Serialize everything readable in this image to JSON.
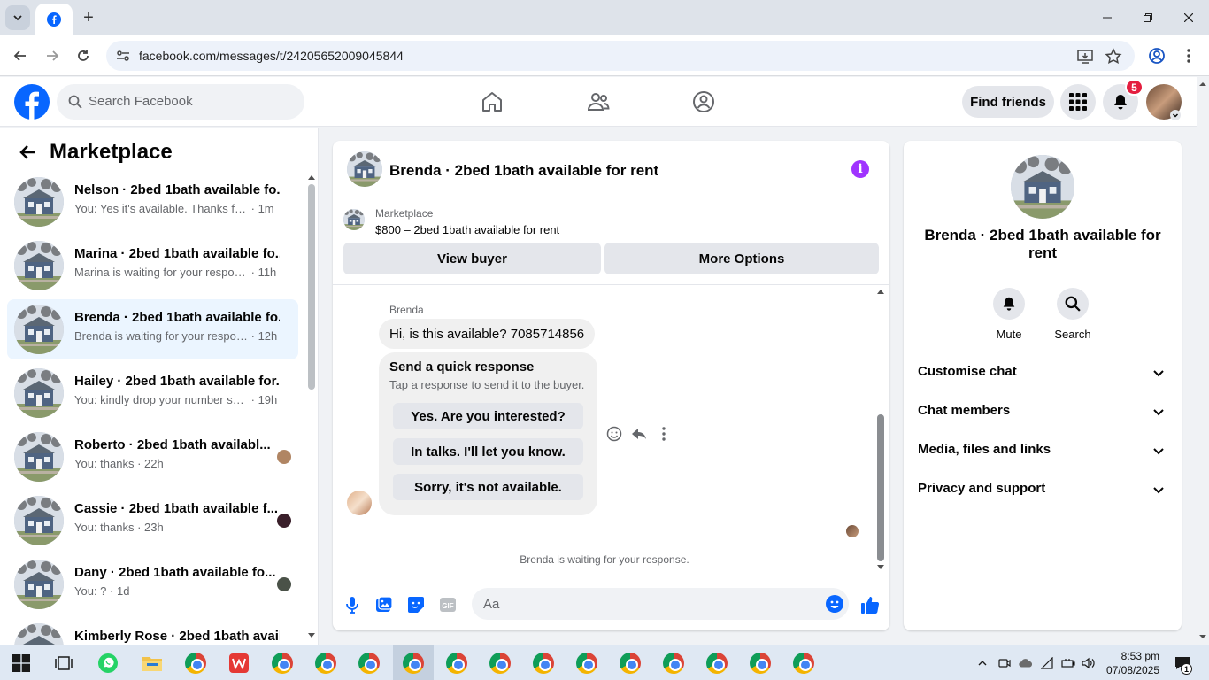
{
  "browser": {
    "url": "facebook.com/messages/t/24205652009045844"
  },
  "fb_header": {
    "search_placeholder": "Search Facebook",
    "find_friends_label": "Find friends",
    "notification_count": "5"
  },
  "left_panel": {
    "title": "Marketplace",
    "conversations": [
      {
        "name": "Nelson · 2bed 1bath available fo...",
        "message": "You: Yes it's available. Thanks for m...",
        "time": "1m"
      },
      {
        "name": "Marina · 2bed 1bath available fo...",
        "message": "Marina is waiting for your response.",
        "time": "11h"
      },
      {
        "name": "Brenda · 2bed 1bath available fo...",
        "message": "Brenda is waiting for your respon...",
        "time": "12h"
      },
      {
        "name": "Hailey · 2bed 1bath available for...",
        "message": "You: kindly drop your number so ...",
        "time": "19h"
      },
      {
        "name": "Roberto · 2bed 1bath availabl...",
        "message": "You: thanks",
        "time": "22h"
      },
      {
        "name": "Cassie · 2bed 1bath available f...",
        "message": "You: thanks",
        "time": "23h"
      },
      {
        "name": "Dany · 2bed 1bath available fo...",
        "message": "You: ?",
        "time": "1d"
      },
      {
        "name": "Kimberly Rose · 2bed 1bath avail...",
        "message": "",
        "time": ""
      }
    ]
  },
  "chat": {
    "title": "Brenda · 2bed 1bath available for rent",
    "marketplace_label": "Marketplace",
    "listing": "$800 – 2bed 1bath available for rent",
    "view_buyer_label": "View buyer",
    "more_options_label": "More Options",
    "sender": "Brenda",
    "message": "Hi, is this available? 7085714856",
    "quick_title": "Send a quick response",
    "quick_subtitle": "Tap a response to send it to the buyer.",
    "quick_options": [
      "Yes. Are you interested?",
      "In talks. I'll let you know.",
      "Sorry, it's not available."
    ],
    "waiting_text": "Brenda is waiting for your response.",
    "composer_placeholder": "Aa"
  },
  "right_panel": {
    "name": "Brenda · 2bed 1bath available for rent",
    "mute_label": "Mute",
    "search_label": "Search",
    "sections": [
      "Customise chat",
      "Chat members",
      "Media, files and links",
      "Privacy and support"
    ]
  },
  "taskbar": {
    "time": "8:53 pm",
    "date": "07/08/2025",
    "notification_count": "1"
  },
  "colors": {
    "fb_blue": "#0866ff",
    "active_conversation": "#ebf5ff",
    "info_purple": "#a033ff",
    "badge_red": "#e41e3f"
  }
}
